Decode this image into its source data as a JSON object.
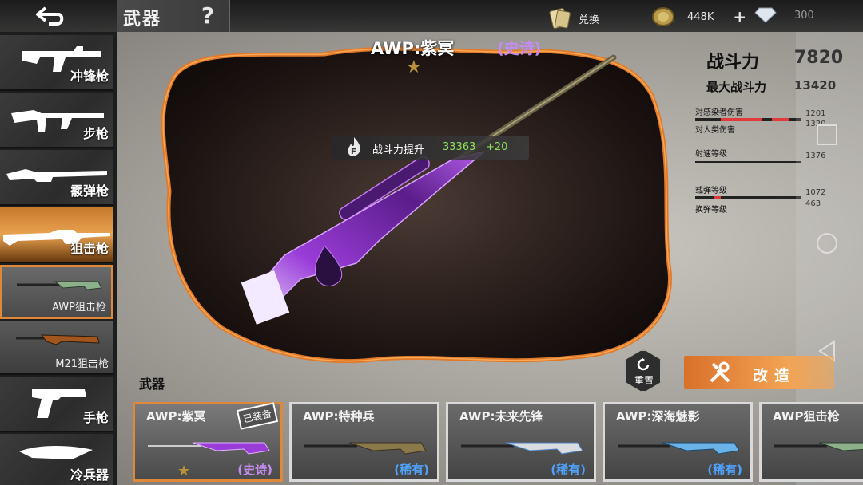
{
  "header": {
    "title": "武器",
    "help_icon": "?",
    "back_icon": "back-arrow-icon",
    "exchange_label": "兑换",
    "coins": "448K",
    "plus": "+",
    "gems": "300"
  },
  "sidebar": {
    "categories": [
      {
        "label": "冲锋枪",
        "icon": "smg-icon"
      },
      {
        "label": "步枪",
        "icon": "rifle-icon"
      },
      {
        "label": "霰弹枪",
        "icon": "shotgun-icon"
      },
      {
        "label": "狙击枪",
        "icon": "sniper-icon",
        "active": true
      }
    ],
    "subitems": [
      {
        "label": "AWP狙击枪",
        "active": true
      },
      {
        "label": "M21狙击枪"
      }
    ],
    "more": [
      {
        "label": "手枪",
        "icon": "pistol-icon"
      },
      {
        "label": "冷兵器",
        "icon": "knife-icon"
      }
    ]
  },
  "weapon": {
    "name": "AWP:紫冥",
    "rarity": "(史诗)",
    "star": "★",
    "boost_label": "战斗力提升",
    "boost_value": "33363",
    "boost_plus": "+20"
  },
  "stats": {
    "power_label": "战斗力",
    "power_value": "7820",
    "max_power_label": "最大战斗力",
    "max_power_value": "13420",
    "rows": [
      {
        "label": "对感染者伤害",
        "value": "1201"
      },
      {
        "label": "对人类伤害",
        "value": "1320"
      },
      {
        "label": "射速等级",
        "value": "1376"
      },
      {
        "label": "载弹等级",
        "value": "1072"
      },
      {
        "label": "换弹等级",
        "value": "463"
      }
    ]
  },
  "actions": {
    "reset_label": "重置",
    "upgrade_label": "改造"
  },
  "list": {
    "title": "武器",
    "equipped_tag": "已装备",
    "cards": [
      {
        "name": "AWP:紫冥",
        "rarity": "(史诗)",
        "rarity_color": "#c48cf0",
        "active": true
      },
      {
        "name": "AWP:特种兵",
        "rarity": "(稀有)",
        "rarity_color": "#4fa3ff"
      },
      {
        "name": "AWP:未来先锋",
        "rarity": "(稀有)",
        "rarity_color": "#4fa3ff"
      },
      {
        "name": "AWP:深海魅影",
        "rarity": "(稀有)",
        "rarity_color": "#4fa3ff"
      },
      {
        "name": "AWP狙击枪",
        "rarity": "",
        "rarity_color": "#4fa3ff"
      }
    ]
  },
  "colors": {
    "accent": "#e0883a",
    "epic": "#c48cf0",
    "rare": "#4fa3ff",
    "boost": "#8be05a"
  }
}
